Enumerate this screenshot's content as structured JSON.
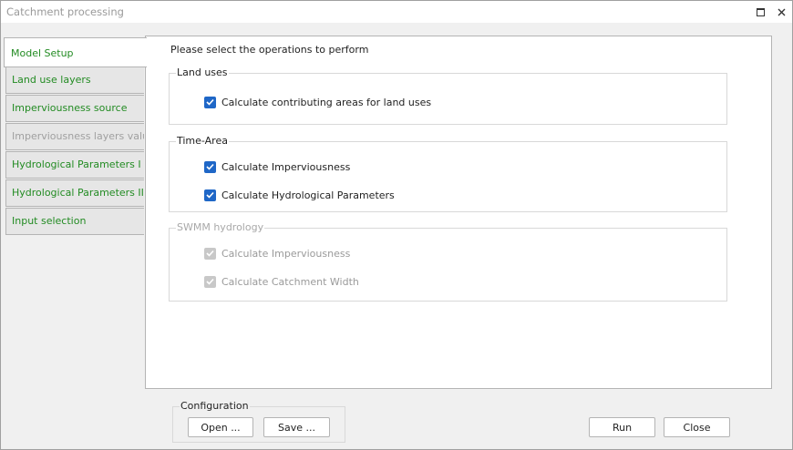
{
  "window": {
    "title": "Catchment processing"
  },
  "tabs": [
    {
      "label": "Model Setup",
      "state": "active"
    },
    {
      "label": "Land use layers",
      "state": "enabled"
    },
    {
      "label": "Imperviousness source",
      "state": "enabled"
    },
    {
      "label": "Imperviousness layers values",
      "state": "disabled"
    },
    {
      "label": "Hydrological Parameters I",
      "state": "enabled"
    },
    {
      "label": "Hydrological Parameters II",
      "state": "enabled"
    },
    {
      "label": "Input selection",
      "state": "enabled"
    }
  ],
  "panel": {
    "prompt": "Please select the operations to perform",
    "groups": [
      {
        "legend": "Land uses",
        "enabled": true,
        "options": [
          {
            "label": "Calculate contributing areas for land uses",
            "checked": true
          }
        ]
      },
      {
        "legend": "Time-Area",
        "enabled": true,
        "options": [
          {
            "label": "Calculate Imperviousness",
            "checked": true
          },
          {
            "label": "Calculate Hydrological Parameters",
            "checked": true
          }
        ]
      },
      {
        "legend": "SWMM hydrology",
        "enabled": false,
        "options": [
          {
            "label": "Calculate Imperviousness",
            "checked": true
          },
          {
            "label": "Calculate Catchment Width",
            "checked": true
          }
        ]
      }
    ]
  },
  "configuration": {
    "legend": "Configuration",
    "open_label": "Open ...",
    "save_label": "Save ..."
  },
  "actions": {
    "run_label": "Run",
    "close_label": "Close"
  },
  "colors": {
    "tab_text": "#228b22",
    "checkbox_checked": "#1f67c7",
    "checkbox_disabled": "#c8c8c8",
    "disabled_text": "#a0a0a0"
  }
}
